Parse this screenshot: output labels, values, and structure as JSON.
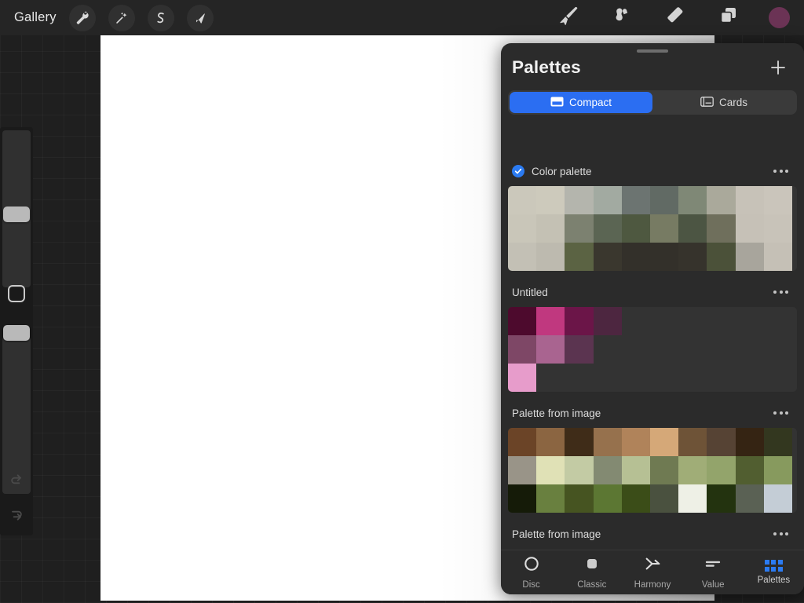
{
  "topbar": {
    "gallery_label": "Gallery",
    "left_tools": [
      {
        "name": "wrench-icon",
        "label": "Actions"
      },
      {
        "name": "magic-wand-icon",
        "label": "Adjustments"
      },
      {
        "name": "selection-icon",
        "label": "Selection"
      },
      {
        "name": "transform-arrow-icon",
        "label": "Transform"
      }
    ],
    "right_tools": [
      {
        "name": "brush-icon",
        "label": "Paint"
      },
      {
        "name": "smudge-icon",
        "label": "Smudge"
      },
      {
        "name": "eraser-icon",
        "label": "Erase"
      },
      {
        "name": "layers-icon",
        "label": "Layers"
      }
    ],
    "color_swatch": "#6b3355"
  },
  "sidebar": {
    "brush_size_label": "Brush size",
    "opacity_label": "Opacity",
    "modify_label": "Modify",
    "undo_label": "Undo",
    "redo_label": "Redo"
  },
  "panel": {
    "title": "Palettes",
    "add_label": "+",
    "segments": [
      {
        "label": "Compact",
        "icon": "compact-view-icon",
        "active": true
      },
      {
        "label": "Cards",
        "icon": "cards-view-icon",
        "active": false
      }
    ],
    "accent_color": "#2b6ef2",
    "palettes": [
      {
        "name": "Color palette",
        "selected": true,
        "menu_label": "More options",
        "rows": [
          [
            "#cbc8bb",
            "#cdcabc",
            "#b4b5ad",
            "#a2aaa1",
            "#6c7471",
            "#616a64",
            "#7f8876",
            "#aaa99b",
            "#c7c2b8",
            "#cac5bb"
          ],
          [
            "#c9c6b9",
            "#c4c1b4",
            "#7c8170",
            "#5b6553",
            "#4e5840",
            "#777b63",
            "#4c5543",
            "#6f6f5c",
            "#c6c1b7",
            "#c8c3b9"
          ],
          [
            "#c3c0b5",
            "#bdbaaf",
            "#5b6343",
            "#3a372e",
            "#33302a",
            "#33302a",
            "#36332c",
            "#4b5139",
            "#a8a59c",
            "#c5c0b6"
          ]
        ]
      },
      {
        "name": "Untitled",
        "selected": false,
        "menu_label": "More options",
        "rows": [
          [
            "#4d0a2d",
            "#c0387f",
            "#6b1548",
            "#4d2640"
          ],
          [
            "#7e4766",
            "#a96490",
            "#5b3450"
          ],
          [
            "#e79ccb"
          ]
        ]
      },
      {
        "name": "Palette from image",
        "selected": false,
        "menu_label": "More options",
        "rows": [
          [
            "#6b4427",
            "#8b6541",
            "#3f2c18",
            "#96714d",
            "#b0835a",
            "#d5a878",
            "#6e5337",
            "#564334",
            "#352413",
            "#33371f"
          ],
          [
            "#999488",
            "#e0e1b6",
            "#c3cba4",
            "#838a72",
            "#b6c094",
            "#6f7a52",
            "#a0ad77",
            "#93a46b",
            "#515e30",
            "#879a5e"
          ],
          [
            "#151b08",
            "#69803f",
            "#465421",
            "#5c7733",
            "#3b4d18",
            "#4a513f",
            "#eef0e6",
            "#23330f",
            "#5a6154",
            "#c4cdd6"
          ]
        ]
      },
      {
        "name": "Palette from image",
        "selected": false,
        "menu_label": "More options",
        "rows": []
      }
    ]
  },
  "tabbar": {
    "tabs": [
      {
        "label": "Disc",
        "icon": "disc-icon",
        "active": false
      },
      {
        "label": "Classic",
        "icon": "classic-icon",
        "active": false
      },
      {
        "label": "Harmony",
        "icon": "harmony-icon",
        "active": false
      },
      {
        "label": "Value",
        "icon": "value-icon",
        "active": false
      },
      {
        "label": "Palettes",
        "icon": "palettes-grid-icon",
        "active": true
      }
    ]
  }
}
